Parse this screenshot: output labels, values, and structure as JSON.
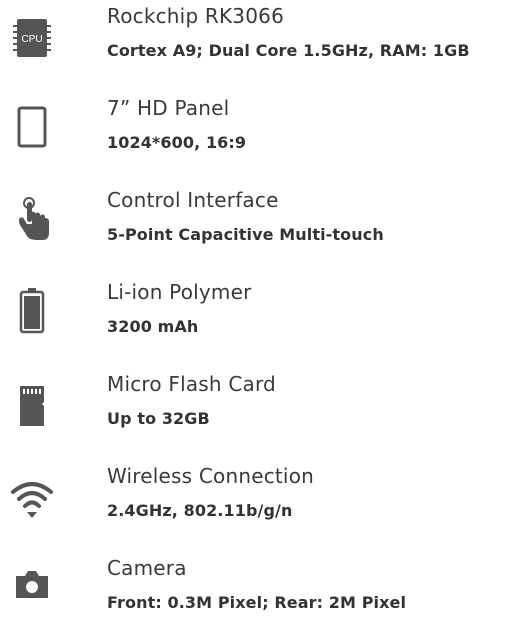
{
  "colors": {
    "icon": "#555555",
    "title": "#3a3a3a",
    "description": "#333333"
  },
  "specs": [
    {
      "icon": "cpu-icon",
      "icon_text": "CPU",
      "title": "Rockchip RK3066",
      "description": "Cortex A9; Dual Core 1.5GHz, RAM: 1GB"
    },
    {
      "icon": "tablet-icon",
      "title": "7” HD Panel",
      "description": "1024*600, 16:9"
    },
    {
      "icon": "touch-hand-icon",
      "title": "Control Interface",
      "description": "5-Point Capacitive Multi-touch"
    },
    {
      "icon": "battery-icon",
      "title": "Li-ion Polymer",
      "description": "3200 mAh"
    },
    {
      "icon": "sd-card-icon",
      "title": "Micro Flash Card",
      "description": "Up to 32GB"
    },
    {
      "icon": "wifi-icon",
      "title": "Wireless Connection",
      "description": "2.4GHz,  802.11b/g/n"
    },
    {
      "icon": "camera-icon",
      "title": "Camera",
      "description": "Front:  0.3M Pixel; Rear: 2M Pixel"
    }
  ]
}
